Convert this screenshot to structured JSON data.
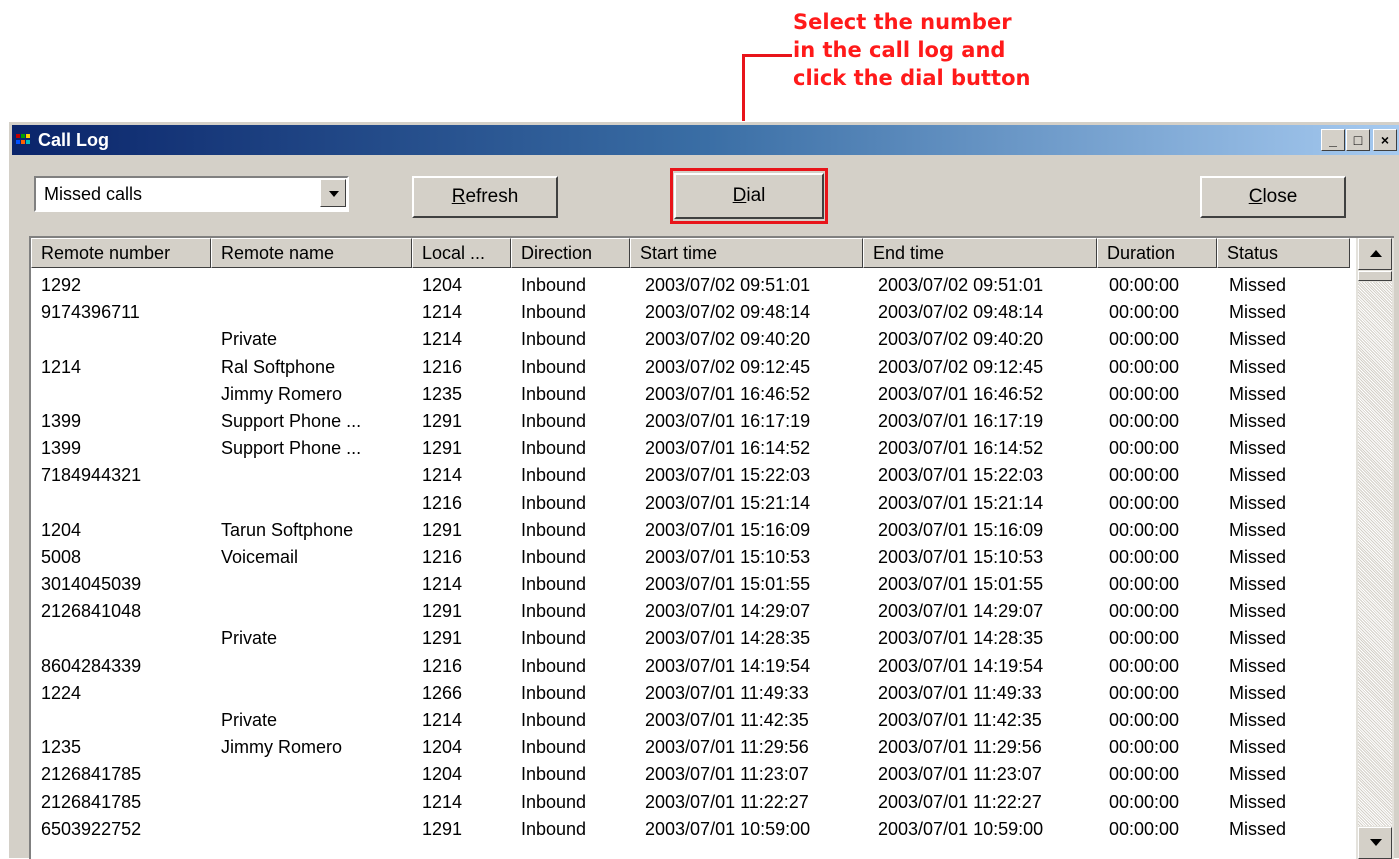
{
  "annotation": {
    "lines": [
      "Select the number",
      "in the call log and",
      "click the dial button"
    ],
    "color": "#e8141a"
  },
  "window": {
    "title": "Call Log",
    "controls": {
      "minimize": "_",
      "maximize": "□",
      "close": "×"
    }
  },
  "toolbar": {
    "filter_selected": "Missed calls",
    "refresh_prefix": "R",
    "refresh_rest": "efresh",
    "dial_prefix": "D",
    "dial_rest": "ial",
    "close_prefix": "C",
    "close_rest": "lose"
  },
  "table": {
    "columns": [
      "Remote number",
      "Remote name",
      "Local ...",
      "Direction",
      "Start time",
      "End time",
      "Duration",
      "Status"
    ],
    "rows": [
      [
        "1292",
        "",
        "1204",
        "Inbound",
        "2003/07/02 09:51:01",
        "2003/07/02 09:51:01",
        "00:00:00",
        "Missed"
      ],
      [
        "9174396711",
        "",
        "1214",
        "Inbound",
        "2003/07/02 09:48:14",
        "2003/07/02 09:48:14",
        "00:00:00",
        "Missed"
      ],
      [
        "",
        "Private",
        "1214",
        "Inbound",
        "2003/07/02 09:40:20",
        "2003/07/02 09:40:20",
        "00:00:00",
        "Missed"
      ],
      [
        "1214",
        "Ral Softphone",
        "1216",
        "Inbound",
        "2003/07/02 09:12:45",
        "2003/07/02 09:12:45",
        "00:00:00",
        "Missed"
      ],
      [
        "",
        "Jimmy Romero",
        "1235",
        "Inbound",
        "2003/07/01 16:46:52",
        "2003/07/01 16:46:52",
        "00:00:00",
        "Missed"
      ],
      [
        "1399",
        "Support Phone ...",
        "1291",
        "Inbound",
        "2003/07/01 16:17:19",
        "2003/07/01 16:17:19",
        "00:00:00",
        "Missed"
      ],
      [
        "1399",
        "Support Phone ...",
        "1291",
        "Inbound",
        "2003/07/01 16:14:52",
        "2003/07/01 16:14:52",
        "00:00:00",
        "Missed"
      ],
      [
        "7184944321",
        "",
        "1214",
        "Inbound",
        "2003/07/01 15:22:03",
        "2003/07/01 15:22:03",
        "00:00:00",
        "Missed"
      ],
      [
        "",
        "",
        "1216",
        "Inbound",
        "2003/07/01 15:21:14",
        "2003/07/01 15:21:14",
        "00:00:00",
        "Missed"
      ],
      [
        "1204",
        "Tarun Softphone",
        "1291",
        "Inbound",
        "2003/07/01 15:16:09",
        "2003/07/01 15:16:09",
        "00:00:00",
        "Missed"
      ],
      [
        "5008",
        "Voicemail",
        "1216",
        "Inbound",
        "2003/07/01 15:10:53",
        "2003/07/01 15:10:53",
        "00:00:00",
        "Missed"
      ],
      [
        "3014045039",
        "",
        "1214",
        "Inbound",
        "2003/07/01 15:01:55",
        "2003/07/01 15:01:55",
        "00:00:00",
        "Missed"
      ],
      [
        "2126841048",
        "",
        "1291",
        "Inbound",
        "2003/07/01 14:29:07",
        "2003/07/01 14:29:07",
        "00:00:00",
        "Missed"
      ],
      [
        "",
        "Private",
        "1291",
        "Inbound",
        "2003/07/01 14:28:35",
        "2003/07/01 14:28:35",
        "00:00:00",
        "Missed"
      ],
      [
        "8604284339",
        "",
        "1216",
        "Inbound",
        "2003/07/01 14:19:54",
        "2003/07/01 14:19:54",
        "00:00:00",
        "Missed"
      ],
      [
        "1224",
        "",
        "1266",
        "Inbound",
        "2003/07/01 11:49:33",
        "2003/07/01 11:49:33",
        "00:00:00",
        "Missed"
      ],
      [
        "",
        "Private",
        "1214",
        "Inbound",
        "2003/07/01 11:42:35",
        "2003/07/01 11:42:35",
        "00:00:00",
        "Missed"
      ],
      [
        "1235",
        "Jimmy Romero",
        "1204",
        "Inbound",
        "2003/07/01 11:29:56",
        "2003/07/01 11:29:56",
        "00:00:00",
        "Missed"
      ],
      [
        "2126841785",
        "",
        "1204",
        "Inbound",
        "2003/07/01 11:23:07",
        "2003/07/01 11:23:07",
        "00:00:00",
        "Missed"
      ],
      [
        "2126841785",
        "",
        "1214",
        "Inbound",
        "2003/07/01 11:22:27",
        "2003/07/01 11:22:27",
        "00:00:00",
        "Missed"
      ],
      [
        "6503922752",
        "",
        "1291",
        "Inbound",
        "2003/07/01 10:59:00",
        "2003/07/01 10:59:00",
        "00:00:00",
        "Missed"
      ]
    ]
  }
}
